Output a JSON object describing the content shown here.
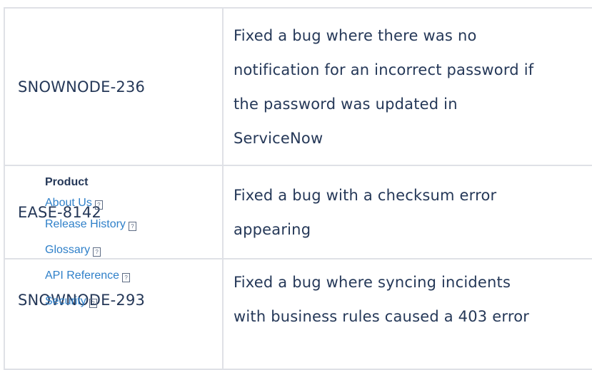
{
  "table": {
    "rows": [
      {
        "key": "SNOWNODE-236",
        "desc": [
          "Fixed a bug where there was no",
          "notification for an incorrect password if",
          "the password was updated in",
          "ServiceNow"
        ]
      },
      {
        "key": "EASE-8142",
        "desc": [
          "Fixed a bug with a checksum error",
          "appearing"
        ]
      },
      {
        "key": "SNOWNODE-293",
        "desc": [
          "Fixed a bug where syncing incidents",
          "with business rules caused a 403 error"
        ]
      }
    ]
  },
  "footer": {
    "heading": "Product",
    "links": [
      "About Us",
      "Release History",
      "Glossary",
      "API Reference",
      "Security"
    ],
    "external_glyph": "?"
  }
}
